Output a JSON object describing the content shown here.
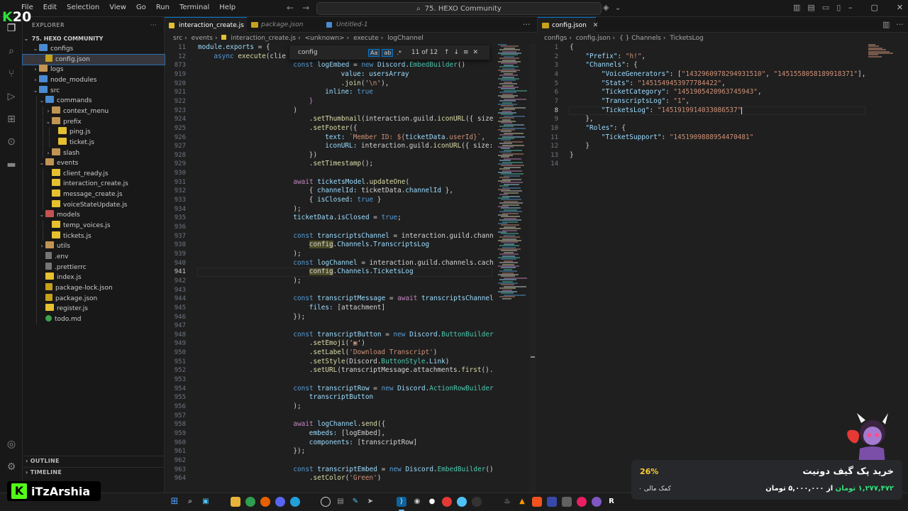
{
  "overlay": {
    "badge_number": "20",
    "streamer_name": "iTzArshia"
  },
  "menu": [
    "File",
    "Edit",
    "Selection",
    "View",
    "Go",
    "Run",
    "Terminal",
    "Help"
  ],
  "command_center": "75. HEXO Community",
  "explorer": {
    "title": "EXPLORER",
    "root": "75. HEXO COMMUNITY",
    "items": [
      {
        "label": "configs",
        "kind": "folder-blue",
        "depth": 1,
        "open": true
      },
      {
        "label": "config.json",
        "kind": "json",
        "depth": 2,
        "selected": true
      },
      {
        "label": "logs",
        "kind": "folder",
        "depth": 1,
        "open": false
      },
      {
        "label": "node_modules",
        "kind": "folder-blue",
        "depth": 1,
        "open": false
      },
      {
        "label": "src",
        "kind": "folder-blue",
        "depth": 1,
        "open": true
      },
      {
        "label": "commands",
        "kind": "folder-blue",
        "depth": 2,
        "open": true
      },
      {
        "label": "context_menu",
        "kind": "folder",
        "depth": 3,
        "open": false
      },
      {
        "label": "prefix",
        "kind": "folder",
        "depth": 3,
        "open": true
      },
      {
        "label": "ping.js",
        "kind": "js",
        "depth": 4
      },
      {
        "label": "ticket.js",
        "kind": "js",
        "depth": 4
      },
      {
        "label": "slash",
        "kind": "folder",
        "depth": 3,
        "open": false
      },
      {
        "label": "events",
        "kind": "folder",
        "depth": 2,
        "open": true
      },
      {
        "label": "client_ready.js",
        "kind": "js",
        "depth": 3
      },
      {
        "label": "interaction_create.js",
        "kind": "js",
        "depth": 3
      },
      {
        "label": "message_create.js",
        "kind": "js",
        "depth": 3
      },
      {
        "label": "voiceStateUpdate.js",
        "kind": "js",
        "depth": 3
      },
      {
        "label": "models",
        "kind": "folder-red",
        "depth": 2,
        "open": true
      },
      {
        "label": "temp_voices.js",
        "kind": "js",
        "depth": 3
      },
      {
        "label": "tickets.js",
        "kind": "js",
        "depth": 3
      },
      {
        "label": "utils",
        "kind": "folder",
        "depth": 2,
        "open": false
      },
      {
        "label": ".env",
        "kind": "env",
        "depth": 2
      },
      {
        "label": ".prettierrc",
        "kind": "env",
        "depth": 2
      },
      {
        "label": "index.js",
        "kind": "js",
        "depth": 2
      },
      {
        "label": "package-lock.json",
        "kind": "json",
        "depth": 2
      },
      {
        "label": "package.json",
        "kind": "json",
        "depth": 2
      },
      {
        "label": "register.js",
        "kind": "js",
        "depth": 2
      },
      {
        "label": "todo.md",
        "kind": "md",
        "depth": 2
      }
    ],
    "outline": "OUTLINE",
    "timeline": "TIMELINE"
  },
  "left_editor": {
    "tabs": [
      {
        "label": "interaction_create.js",
        "active": true
      },
      {
        "label": "package.json",
        "active": false
      },
      {
        "label": "Untitled-1",
        "active": false
      }
    ],
    "breadcrumb": [
      "src",
      "events",
      "interaction_create.js",
      "<unknown>",
      "execute",
      "logChannel"
    ],
    "find": {
      "query": "config",
      "count": "11 of 12",
      "case": "Aa",
      "word": "ab",
      "regex": ".*"
    }
  },
  "right_editor": {
    "tab": "config.json",
    "breadcrumb": [
      "configs",
      "config.json",
      "{ } Channels",
      "TicketsLog"
    ]
  },
  "code_left": [
    {
      "n": "11",
      "t": [
        [
          "module",
          "var"
        ],
        [
          ".",
          ""
        ],
        [
          "exports",
          "var"
        ],
        [
          " = {",
          ""
        ]
      ],
      "i": 0
    },
    {
      "n": "12",
      "t": [
        [
          "async ",
          "kw"
        ],
        [
          "execute",
          "fn"
        ],
        [
          "(clie",
          ""
        ]
      ],
      "i": 1
    },
    {
      "n": "873",
      "t": [
        [
          "const ",
          "kw"
        ],
        [
          "logEmbed",
          "var"
        ],
        [
          " = ",
          ""
        ],
        [
          "new ",
          "kw"
        ],
        [
          "Discord",
          "var"
        ],
        [
          ".",
          ""
        ],
        [
          "EmbedBuilder",
          "cls"
        ],
        [
          "()",
          ""
        ]
      ],
      "i": 6
    },
    {
      "n": "919",
      "t": [
        [
          "value: ",
          "var"
        ],
        [
          "usersArray",
          "var"
        ]
      ],
      "i": 9
    },
    {
      "n": "920",
      "t": [
        [
          ".join",
          "fn"
        ],
        [
          "('",
          ""
        ],
        [
          "\\n",
          "str"
        ],
        [
          "'),",
          ""
        ]
      ],
      "i": 9
    },
    {
      "n": "921",
      "t": [
        [
          "inline: ",
          "var"
        ],
        [
          "true",
          "kw"
        ]
      ],
      "i": 8
    },
    {
      "n": "922",
      "t": [
        [
          "}",
          "kw2"
        ]
      ],
      "i": 7
    },
    {
      "n": "923",
      "t": [
        [
          ")",
          ""
        ]
      ],
      "i": 6
    },
    {
      "n": "924",
      "t": [
        [
          ".setThumbnail",
          "fn"
        ],
        [
          "(interaction.guild.",
          ""
        ],
        [
          "iconURL",
          "fn"
        ],
        [
          "({ size",
          ""
        ]
      ],
      "i": 7
    },
    {
      "n": "925",
      "t": [
        [
          ".setFooter",
          "fn"
        ],
        [
          "({",
          ""
        ]
      ],
      "i": 7
    },
    {
      "n": "926",
      "t": [
        [
          "text: ",
          "var"
        ],
        [
          "`Member ID: ${",
          "str"
        ],
        [
          "ticketData",
          "var"
        ],
        [
          ".userId}`",
          "str"
        ],
        [
          ",",
          ""
        ]
      ],
      "i": 8
    },
    {
      "n": "927",
      "t": [
        [
          "iconURL: ",
          "var"
        ],
        [
          "interaction.guild.",
          ""
        ],
        [
          "iconURL",
          "fn"
        ],
        [
          "({ size:",
          ""
        ]
      ],
      "i": 8
    },
    {
      "n": "928",
      "t": [
        [
          "})",
          ""
        ]
      ],
      "i": 7
    },
    {
      "n": "929",
      "t": [
        [
          ".setTimestamp",
          "fn"
        ],
        [
          "();",
          ""
        ]
      ],
      "i": 7
    },
    {
      "n": "930",
      "t": [],
      "i": 0
    },
    {
      "n": "931",
      "t": [
        [
          "await ",
          "kw2"
        ],
        [
          "ticketsModel",
          "var"
        ],
        [
          ".",
          ""
        ],
        [
          "updateOne",
          "fn"
        ],
        [
          "(",
          ""
        ]
      ],
      "i": 6
    },
    {
      "n": "932",
      "t": [
        [
          "{ ",
          ""
        ],
        [
          "channelId",
          "var"
        ],
        [
          ": ticketData.",
          ""
        ],
        [
          "channelId",
          "var"
        ],
        [
          " },",
          ""
        ]
      ],
      "i": 7
    },
    {
      "n": "933",
      "t": [
        [
          "{ ",
          ""
        ],
        [
          "isClosed",
          "var"
        ],
        [
          ": ",
          ""
        ],
        [
          "true",
          "kw"
        ],
        [
          " }",
          ""
        ]
      ],
      "i": 7
    },
    {
      "n": "934",
      "t": [
        [
          ");",
          ""
        ]
      ],
      "i": 6
    },
    {
      "n": "935",
      "t": [
        [
          "ticketData",
          "var"
        ],
        [
          ".",
          ""
        ],
        [
          "isClosed",
          "var"
        ],
        [
          " = ",
          ""
        ],
        [
          "true",
          "kw"
        ],
        [
          ";",
          ""
        ]
      ],
      "i": 6
    },
    {
      "n": "936",
      "t": [],
      "i": 0
    },
    {
      "n": "937",
      "t": [
        [
          "const ",
          "kw"
        ],
        [
          "transcriptsChannel",
          "var"
        ],
        [
          " = interaction.guild.chann",
          ""
        ]
      ],
      "i": 6
    },
    {
      "n": "938",
      "t": [
        [
          "config",
          "hl"
        ],
        [
          ".",
          ""
        ],
        [
          "Channels",
          "var"
        ],
        [
          ".",
          ""
        ],
        [
          "TranscriptsLog",
          "var"
        ]
      ],
      "i": 7
    },
    {
      "n": "939",
      "t": [
        [
          ");",
          ""
        ]
      ],
      "i": 6
    },
    {
      "n": "940",
      "t": [
        [
          "const ",
          "kw"
        ],
        [
          "logChannel",
          "var"
        ],
        [
          " = interaction.guild.channels.cach",
          ""
        ]
      ],
      "i": 6
    },
    {
      "n": "941",
      "t": [
        [
          "config",
          "hl"
        ],
        [
          ".",
          ""
        ],
        [
          "Channels",
          "var"
        ],
        [
          ".",
          ""
        ],
        [
          "TicketsLog",
          "var"
        ]
      ],
      "i": 7
    },
    {
      "n": "942",
      "t": [
        [
          ");",
          ""
        ]
      ],
      "i": 6
    },
    {
      "n": "943",
      "t": [],
      "i": 0
    },
    {
      "n": "944",
      "t": [
        [
          "const ",
          "kw"
        ],
        [
          "transcriptMessage",
          "var"
        ],
        [
          " = ",
          ""
        ],
        [
          "await ",
          "kw2"
        ],
        [
          "transcriptsChannel",
          "var"
        ]
      ],
      "i": 6
    },
    {
      "n": "945",
      "t": [
        [
          "files: ",
          "var"
        ],
        [
          "[attachment]",
          ""
        ]
      ],
      "i": 7
    },
    {
      "n": "946",
      "t": [
        [
          "});",
          ""
        ]
      ],
      "i": 6
    },
    {
      "n": "947",
      "t": [],
      "i": 0
    },
    {
      "n": "948",
      "t": [
        [
          "const ",
          "kw"
        ],
        [
          "transcriptButton",
          "var"
        ],
        [
          " = ",
          ""
        ],
        [
          "new ",
          "kw"
        ],
        [
          "Discord",
          "var"
        ],
        [
          ".",
          ""
        ],
        [
          "ButtonBuilder",
          "cls"
        ]
      ],
      "i": 6
    },
    {
      "n": "949",
      "t": [
        [
          ".setEmoji",
          "fn"
        ],
        [
          "('",
          ""
        ],
        [
          "▣",
          "str"
        ],
        [
          "')",
          ""
        ]
      ],
      "i": 7
    },
    {
      "n": "950",
      "t": [
        [
          ".setLabel",
          "fn"
        ],
        [
          "(",
          ""
        ],
        [
          "'Download Transcript'",
          "str"
        ],
        [
          ")",
          ""
        ]
      ],
      "i": 7
    },
    {
      "n": "951",
      "t": [
        [
          ".setStyle",
          "fn"
        ],
        [
          "(Discord.",
          ""
        ],
        [
          "ButtonStyle",
          "cls"
        ],
        [
          ".",
          ""
        ],
        [
          "Link",
          "var"
        ],
        [
          ")",
          ""
        ]
      ],
      "i": 7
    },
    {
      "n": "952",
      "t": [
        [
          ".setURL",
          "fn"
        ],
        [
          "(transcriptMessage.attachments.",
          ""
        ],
        [
          "first",
          "fn"
        ],
        [
          "().",
          ""
        ]
      ],
      "i": 7
    },
    {
      "n": "953",
      "t": [],
      "i": 0
    },
    {
      "n": "954",
      "t": [
        [
          "const ",
          "kw"
        ],
        [
          "transcriptRow",
          "var"
        ],
        [
          " = ",
          ""
        ],
        [
          "new ",
          "kw"
        ],
        [
          "Discord",
          "var"
        ],
        [
          ".",
          ""
        ],
        [
          "ActionRowBuilder",
          "cls"
        ]
      ],
      "i": 6
    },
    {
      "n": "955",
      "t": [
        [
          "transcriptButton",
          "var"
        ]
      ],
      "i": 7
    },
    {
      "n": "956",
      "t": [
        [
          ");",
          ""
        ]
      ],
      "i": 6
    },
    {
      "n": "957",
      "t": [],
      "i": 0
    },
    {
      "n": "958",
      "t": [
        [
          "await ",
          "kw2"
        ],
        [
          "logChannel",
          "var"
        ],
        [
          ".",
          ""
        ],
        [
          "send",
          "fn"
        ],
        [
          "({",
          ""
        ]
      ],
      "i": 6
    },
    {
      "n": "959",
      "t": [
        [
          "embeds: ",
          "var"
        ],
        [
          "[logEmbed],",
          ""
        ]
      ],
      "i": 7
    },
    {
      "n": "960",
      "t": [
        [
          "components: ",
          "var"
        ],
        [
          "[transcriptRow]",
          ""
        ]
      ],
      "i": 7
    },
    {
      "n": "961",
      "t": [
        [
          "});",
          ""
        ]
      ],
      "i": 6
    },
    {
      "n": "962",
      "t": [],
      "i": 0
    },
    {
      "n": "963",
      "t": [
        [
          "const ",
          "kw"
        ],
        [
          "transcriptEmbed",
          "var"
        ],
        [
          " = ",
          ""
        ],
        [
          "new ",
          "kw"
        ],
        [
          "Discord",
          "var"
        ],
        [
          ".",
          ""
        ],
        [
          "EmbedBuilder",
          "cls"
        ],
        [
          "()",
          ""
        ]
      ],
      "i": 6
    },
    {
      "n": "964",
      "t": [
        [
          ".setColor",
          "fn"
        ],
        [
          "(",
          ""
        ],
        [
          "'Green'",
          "str"
        ],
        [
          ")",
          ""
        ]
      ],
      "i": 7
    }
  ],
  "code_right": [
    {
      "n": "1",
      "t": [
        [
          "{",
          ""
        ]
      ],
      "i": 0
    },
    {
      "n": "2",
      "t": [
        [
          "\"Prefix\"",
          "jkey"
        ],
        [
          ": ",
          ""
        ],
        [
          "\"h!\"",
          "jstr"
        ],
        [
          ",",
          ""
        ]
      ],
      "i": 1
    },
    {
      "n": "3",
      "t": [
        [
          "\"Channels\"",
          "jkey"
        ],
        [
          ": {",
          ""
        ]
      ],
      "i": 1
    },
    {
      "n": "4",
      "t": [
        [
          "\"VoiceGenerators\"",
          "jkey"
        ],
        [
          ": [",
          ""
        ],
        [
          "\"1432960978294931510\"",
          "jstr"
        ],
        [
          ", ",
          ""
        ],
        [
          "\"1451558058189918371\"",
          "jstr"
        ],
        [
          "],",
          ""
        ]
      ],
      "i": 2
    },
    {
      "n": "5",
      "t": [
        [
          "\"Stats\"",
          "jkey"
        ],
        [
          ": ",
          ""
        ],
        [
          "\"1451549453977784422\"",
          "jstr"
        ],
        [
          ",",
          ""
        ]
      ],
      "i": 2
    },
    {
      "n": "6",
      "t": [
        [
          "\"TicketCategory\"",
          "jkey"
        ],
        [
          ": ",
          ""
        ],
        [
          "\"1451905420963745943\"",
          "jstr"
        ],
        [
          ",",
          ""
        ]
      ],
      "i": 2
    },
    {
      "n": "7",
      "t": [
        [
          "\"TranscriptsLog\"",
          "jkey"
        ],
        [
          ": ",
          ""
        ],
        [
          "\"1\"",
          "jstr"
        ],
        [
          ",",
          ""
        ]
      ],
      "i": 2
    },
    {
      "n": "8",
      "t": [
        [
          "\"TicketsLog\"",
          "jkey"
        ],
        [
          ": ",
          ""
        ],
        [
          "\"1451919914033086537\"",
          "jstr"
        ]
      ],
      "i": 2
    },
    {
      "n": "9",
      "t": [
        [
          "},",
          ""
        ]
      ],
      "i": 1
    },
    {
      "n": "10",
      "t": [
        [
          "\"Roles\"",
          "jkey"
        ],
        [
          ": {",
          ""
        ]
      ],
      "i": 1
    },
    {
      "n": "11",
      "t": [
        [
          "\"TicketSupport\"",
          "jkey"
        ],
        [
          ": ",
          ""
        ],
        [
          "\"1451909888954470481\"",
          "jstr"
        ]
      ],
      "i": 2
    },
    {
      "n": "12",
      "t": [
        [
          "}",
          ""
        ]
      ],
      "i": 1
    },
    {
      "n": "13",
      "t": [
        [
          "}",
          ""
        ]
      ],
      "i": 0
    },
    {
      "n": "14",
      "t": [],
      "i": 0
    }
  ],
  "donate": {
    "percent": "26%",
    "donors": "۰ کمک مالی",
    "title": "خرید پک گیف دونیت",
    "amount_raised": "۱,۲۷۷,۴۷۲ تومان",
    "amount_goal": "از ۵,۰۰۰,۰۰۰ تومان"
  }
}
